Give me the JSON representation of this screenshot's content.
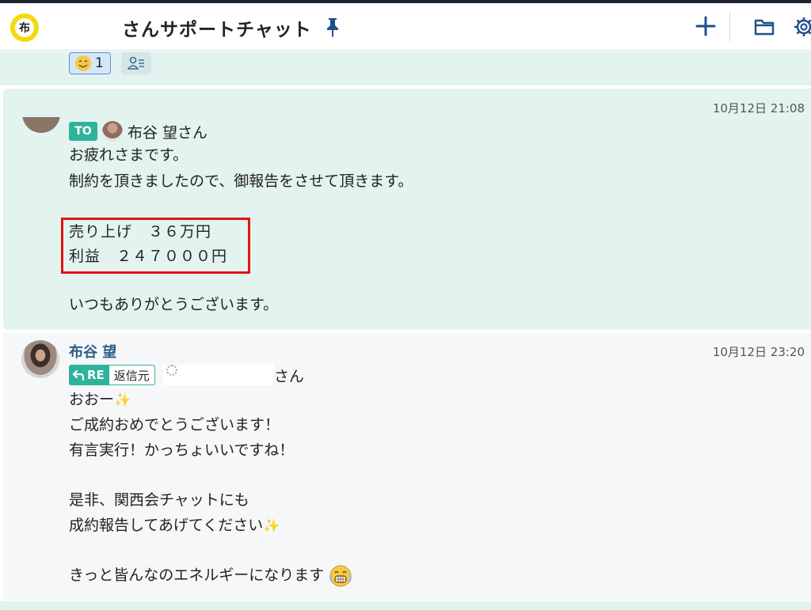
{
  "header": {
    "room_icon_char": "布",
    "title": "さんサポートチャット",
    "pin_icon": "pin-icon",
    "add_icon": "plus-icon",
    "folder_icon": "folder-icon",
    "settings_icon": "gear-icon"
  },
  "reaction_bar": {
    "reaction_count": "1",
    "reaction_icon": "smile-face-icon",
    "users_icon": "reaction-users-icon"
  },
  "message1": {
    "timestamp": "10月12日 21:08",
    "to_label": "TO",
    "to_name": "布谷 望さん",
    "lines": {
      "l1": "お疲れさまです。",
      "l2": "制約を頂きましたので、御報告をさせて頂きます。",
      "l3": "売り上げ　３６万円",
      "l4": "利益　２４７０００円",
      "l5": "いつもありがとうございます。"
    },
    "highlight_color": "#e01414"
  },
  "message2": {
    "sender": "布谷 望",
    "timestamp": "10月12日 23:20",
    "re_label": "RE",
    "reply_source_label": "返信元",
    "reply_to_suffix": "さん",
    "lines": {
      "l1": "おおー",
      "l2": "ご成約おめでとうございます！",
      "l3": "有言実行！かっちょいいですね！",
      "l4": "是非、関西会チャットにも",
      "l5": "成約報告してあげてください",
      "l6": "きっと皆んなのエネルギーになります"
    },
    "sparkle_glyph": "✨"
  },
  "colors": {
    "accent_teal": "#2eb39c",
    "mention_bg": "#e3f3f0",
    "sender_blue": "#2b5d8a",
    "header_icon_blue": "#1f4e8c"
  }
}
